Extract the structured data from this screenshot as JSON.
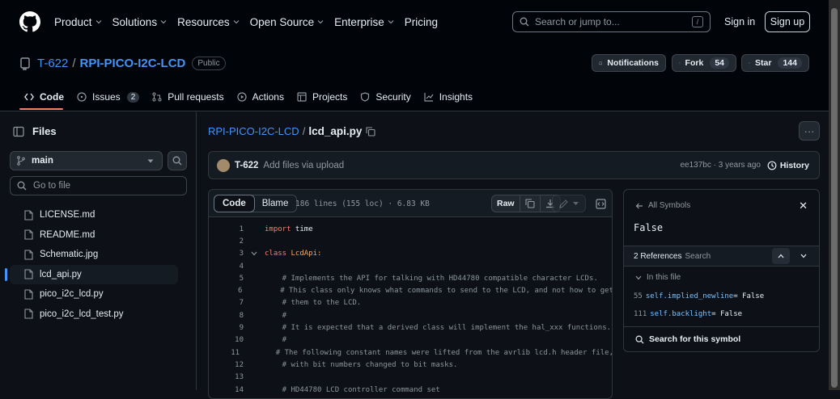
{
  "header": {
    "nav": [
      "Product",
      "Solutions",
      "Resources",
      "Open Source",
      "Enterprise",
      "Pricing"
    ],
    "search_placeholder": "Search or jump to...",
    "search_shortcut": "/",
    "signin": "Sign in",
    "signup": "Sign up"
  },
  "repo": {
    "owner": "T-622",
    "separator": "/",
    "name": "RPI-PICO-I2C-LCD",
    "visibility": "Public",
    "notifications_label": "Notifications",
    "fork_label": "Fork",
    "fork_count": "54",
    "star_label": "Star",
    "star_count": "144"
  },
  "tabs": [
    {
      "label": "Code",
      "icon": "code-icon"
    },
    {
      "label": "Issues",
      "icon": "issue-icon",
      "count": "2"
    },
    {
      "label": "Pull requests",
      "icon": "pull-request-icon"
    },
    {
      "label": "Actions",
      "icon": "play-icon"
    },
    {
      "label": "Projects",
      "icon": "table-icon"
    },
    {
      "label": "Security",
      "icon": "shield-icon"
    },
    {
      "label": "Insights",
      "icon": "graph-icon"
    }
  ],
  "sidebar": {
    "title": "Files",
    "branch": "main",
    "goto_placeholder": "Go to file",
    "files": [
      "LICENSE.md",
      "README.md",
      "Schematic.jpg",
      "lcd_api.py",
      "pico_i2c_lcd.py",
      "pico_i2c_lcd_test.py"
    ],
    "active_index": 3
  },
  "breadcrumb": {
    "repo": "RPI-PICO-I2C-LCD",
    "separator": "/",
    "file": "lcd_api.py"
  },
  "commit": {
    "author": "T-622",
    "message": "Add files via upload",
    "meta": "ee137bc · 3 years ago",
    "history_label": "History"
  },
  "code": {
    "tab_code": "Code",
    "tab_blame": "Blame",
    "info": "186 lines (155 loc) · 6.83 KB",
    "raw_label": "Raw",
    "lines": [
      {
        "n": "1",
        "a": "import",
        "b": " time"
      },
      {
        "n": "2",
        "a": "",
        "b": ""
      },
      {
        "n": "3",
        "a": "class",
        "b": " LcdApi:"
      },
      {
        "n": "4",
        "a": "",
        "b": ""
      },
      {
        "n": "5",
        "a": "",
        "b": "    # Implements the API for talking with HD44780 compatible character LCDs."
      },
      {
        "n": "6",
        "a": "",
        "b": "    # This class only knows what commands to send to the LCD, and not how to get"
      },
      {
        "n": "7",
        "a": "",
        "b": "    # them to the LCD."
      },
      {
        "n": "8",
        "a": "",
        "b": "    #"
      },
      {
        "n": "9",
        "a": "",
        "b": "    # It is expected that a derived class will implement the hal_xxx functions."
      },
      {
        "n": "10",
        "a": "",
        "b": "    #"
      },
      {
        "n": "11",
        "a": "",
        "b": "    # The following constant names were lifted from the avrlib lcd.h header file,"
      },
      {
        "n": "12",
        "a": "",
        "b": "    # with bit numbers changed to bit masks."
      },
      {
        "n": "13",
        "a": "",
        "b": ""
      },
      {
        "n": "14",
        "a": "",
        "b": "    # HD44780 LCD controller command set"
      }
    ]
  },
  "symbols": {
    "back_label": "All Symbols",
    "close": "✕",
    "name": "False",
    "refs_label": "2 References",
    "refs_search": "Search",
    "in_file": "In this file",
    "refs": [
      {
        "line": "55",
        "pre": "self.implied_newline",
        "post": " = False"
      },
      {
        "line": "111",
        "pre": "self.backlight",
        "post": " = False"
      }
    ],
    "search_symbol": "Search for this symbol"
  },
  "colors": {
    "accent": "#4493f8",
    "tab_underline": "#f78166",
    "bg": "#0d1117"
  }
}
